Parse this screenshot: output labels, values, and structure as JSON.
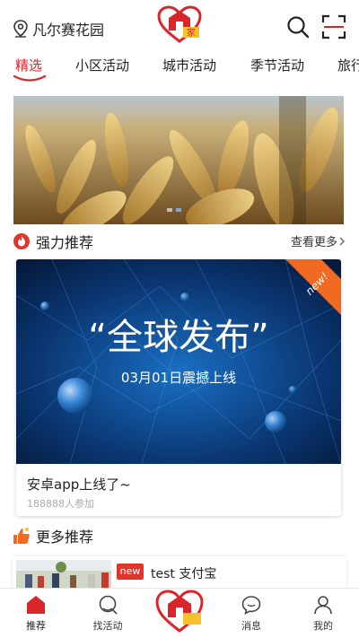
{
  "header": {
    "location": "凡尔赛花园",
    "logo_text": "家"
  },
  "tabs": [
    {
      "label": "精选",
      "active": true
    },
    {
      "label": "小区活动",
      "active": false
    },
    {
      "label": "城市活动",
      "active": false
    },
    {
      "label": "季节活动",
      "active": false
    },
    {
      "label": "旅行",
      "active": false
    }
  ],
  "banner": {
    "slides": 2,
    "active_slide": 2
  },
  "strong_recommend": {
    "title": "强力推荐",
    "more_label": "查看更多"
  },
  "featured_card": {
    "badge": "new!",
    "headline": "“全球发布”",
    "subline": "03月01日震撼上线",
    "title": "安卓app上线了~",
    "participants": "188888人参加"
  },
  "more_recommend": {
    "title": "更多推荐",
    "items": [
      {
        "badge": "new",
        "title": "test 支付宝"
      }
    ]
  },
  "bottom_nav": [
    {
      "label": "推荐",
      "active": true
    },
    {
      "label": "找活动",
      "active": false
    },
    {
      "label": "",
      "active": false
    },
    {
      "label": "消息",
      "active": false
    },
    {
      "label": "我的",
      "active": false
    }
  ],
  "colors": {
    "accent": "#d8262b",
    "badge_orange": "#f26a21"
  }
}
